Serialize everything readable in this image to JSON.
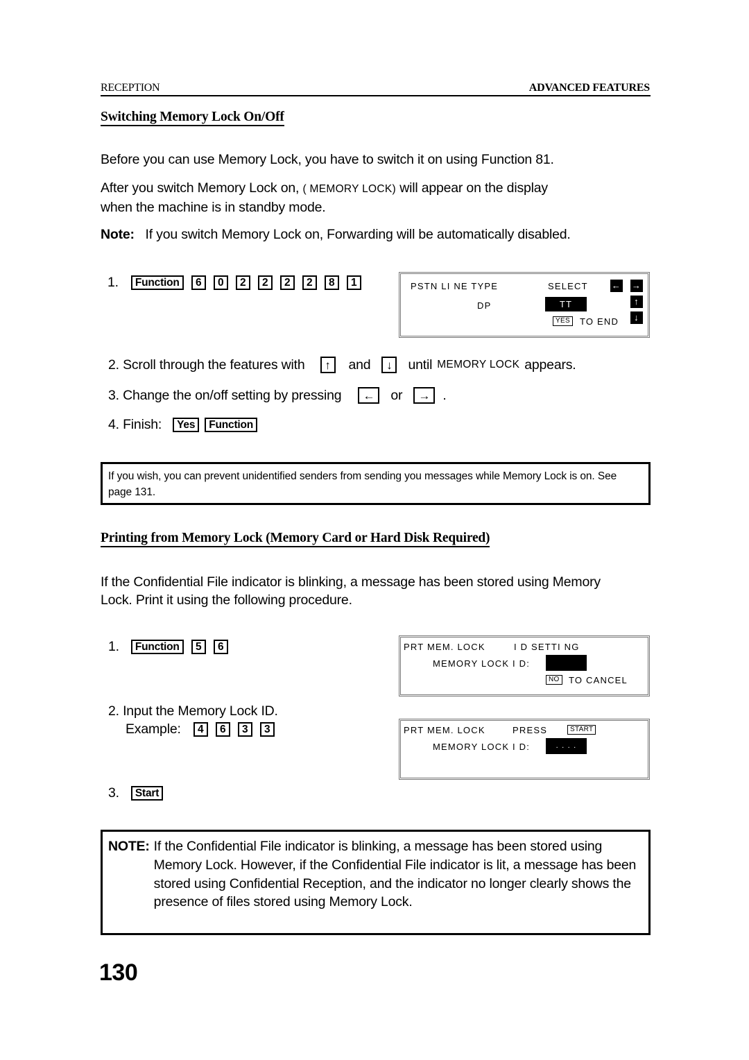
{
  "header": {
    "left": "RECEPTION",
    "right": "ADVANCED FEATURES"
  },
  "section1": {
    "title": "Switching Memory Lock On/Off",
    "para1": "Before you can use Memory Lock, you have to switch it on using Function 81.",
    "para2_before": "After you switch Memory Lock on,",
    "para2_display": "( MEMORY LOCK)",
    "para2_after": "will appear on the display",
    "para2_line2": "when the machine is in standby mode.",
    "note_label": "Note:",
    "note_text": "If you switch Memory Lock on, Forwarding will be automatically disabled.",
    "steps": {
      "step1": {
        "num": "1.",
        "keys": [
          "Function",
          "6",
          "0",
          "2",
          "2",
          "2",
          "2",
          "8",
          "1"
        ]
      },
      "step2": {
        "text_before": "2. Scroll through the features with",
        "key_up": "↑",
        "and": "and",
        "key_down": "↓",
        "until": "until",
        "display": "MEMORY LOCK",
        "text_after": "appears."
      },
      "step3": {
        "text_before": "3. Change the on/off setting by pressing",
        "key_left": "←",
        "or": "or",
        "key_right": "→",
        "period": "."
      },
      "step4": {
        "text": "4. Finish:",
        "keys": [
          "Yes",
          "Function"
        ]
      }
    },
    "lcd": {
      "line1_left": "PSTN LI NE TYPE",
      "line1_right": "SELECT",
      "line2_left": "DP",
      "line2_selected": "TT",
      "line3_key": "YES",
      "line3_text": "TO END",
      "arrow_left": "←",
      "arrow_right": "→",
      "arrow_up": "↑",
      "arrow_down": "↓"
    },
    "tip": "If you wish, you can prevent unidentified senders from sending you messages while Memory Lock is on. See page 131."
  },
  "section2": {
    "title": "Printing from Memory Lock (Memory Card or Hard Disk Required)",
    "para": "If the Confidential File indicator is blinking, a message has been stored using Memory Lock. Print it using the following procedure.",
    "steps": {
      "step1": {
        "num": "1.",
        "keys": [
          "Function",
          "5",
          "6"
        ]
      },
      "step2": {
        "line1": "2. Input the Memory Lock ID.",
        "example_label": "Example:",
        "keys": [
          "4",
          "6",
          "3",
          "3"
        ]
      },
      "step3": {
        "num": "3.",
        "key": "Start"
      }
    },
    "lcd1": {
      "line1_left": "PRT MEM.  LOCK",
      "line1_right": "I D SETTI NG",
      "line2_label": "MEMORY LOCK I D:",
      "line2_value": "",
      "line3_key": "NO",
      "line3_text": "TO CANCEL"
    },
    "lcd2": {
      "line1_left": "PRT MEM.  LOCK",
      "line1_mid": "PRESS",
      "line1_key": "START",
      "line2_label": "MEMORY LOCK I D:",
      "line2_value": ". . . ."
    },
    "note_label": "NOTE:",
    "note_text": "If the Confidential File indicator is blinking, a message has been stored using Memory Lock. However, if the Confidential File indicator is lit, a message has been stored using Confidential Reception, and the indicator no longer clearly shows the presence of files stored using Memory Lock."
  },
  "footer": {
    "page_number": "130"
  }
}
